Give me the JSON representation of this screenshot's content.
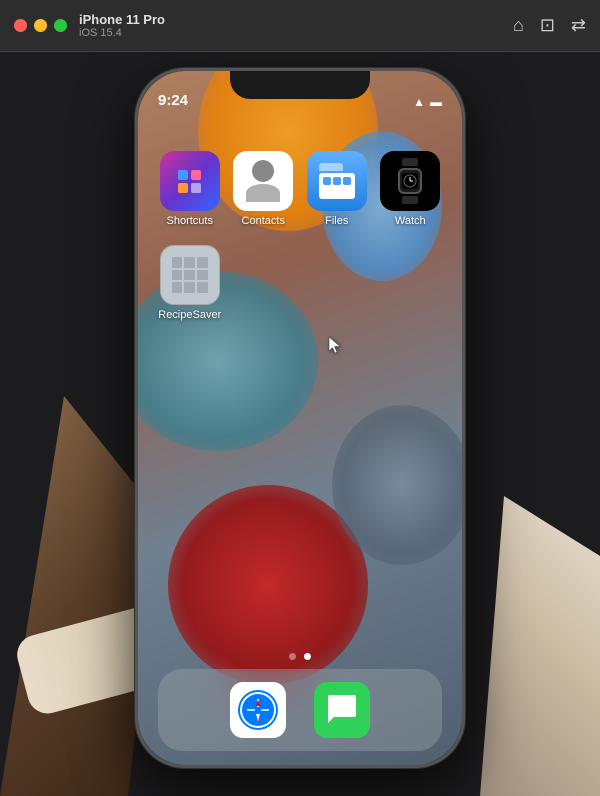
{
  "titlebar": {
    "device": "iPhone 11 Pro",
    "ios": "iOS 15.4",
    "traffic_lights": [
      "red",
      "yellow",
      "green"
    ]
  },
  "status_bar": {
    "time": "9:24",
    "wifi_icon": "wifi",
    "battery_icon": "battery"
  },
  "apps": {
    "row1": [
      {
        "id": "shortcuts",
        "label": "Shortcuts"
      },
      {
        "id": "contacts",
        "label": "Contacts"
      },
      {
        "id": "files",
        "label": "Files"
      },
      {
        "id": "watch",
        "label": "Watch"
      }
    ],
    "row2": [
      {
        "id": "recipesaver",
        "label": "RecipeSaver"
      }
    ]
  },
  "dock": {
    "apps": [
      {
        "id": "safari",
        "label": "Safari"
      },
      {
        "id": "messages",
        "label": "Messages"
      }
    ]
  },
  "page_dots": {
    "total": 2,
    "active": 1
  }
}
